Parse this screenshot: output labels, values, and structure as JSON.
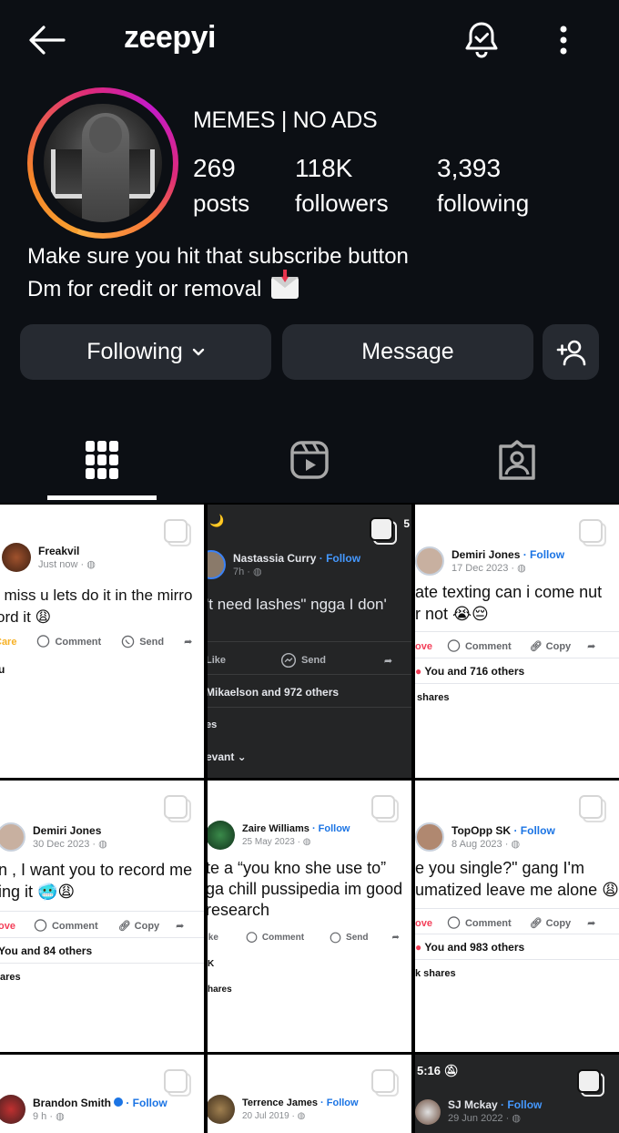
{
  "header": {
    "username": "zeepyi",
    "back_icon": "arrow-left-icon",
    "notifications_icon": "bell-check-icon",
    "more_icon": "more-vertical-icon"
  },
  "profile": {
    "display_name": "MEMES | NO ADS",
    "stats": {
      "posts": {
        "value": "269",
        "label": "posts"
      },
      "followers": {
        "value": "118K",
        "label": "followers"
      },
      "following": {
        "value": "3,393",
        "label": "following"
      }
    },
    "bio": {
      "line1": "Make sure you hit that subscribe button",
      "line2": "Dm for credit or removal",
      "line2_emoji": "envelope-with-arrow-icon"
    },
    "story_ring_colors": [
      "#fcaf45",
      "#f58529",
      "#dd2a7b",
      "#c41ac8"
    ]
  },
  "actions": {
    "following_label": "Following",
    "message_label": "Message",
    "add_user_icon": "person-add-icon"
  },
  "tabs": [
    {
      "name": "posts-grid",
      "icon": "grid-icon",
      "active": true
    },
    {
      "name": "reels",
      "icon": "reels-icon",
      "active": false
    },
    {
      "name": "tagged",
      "icon": "tagged-person-icon",
      "active": false
    }
  ],
  "grid": [
    {
      "author": "Freakvil",
      "follow": "",
      "meta": "Just now ·",
      "text": [
        "i miss u lets do it in the mirro",
        "ord it 😩"
      ],
      "actions": [
        "Care",
        "Comment",
        "Send"
      ],
      "reactions": "u",
      "shares": ""
    },
    {
      "status_time": "🌙",
      "status_right": "5",
      "author": "Nastassia Curry",
      "follow": "· Follow",
      "meta": "7h ·",
      "text": [
        "'t need lashes\" ngga I don'"
      ],
      "actions": [
        "Like",
        "Send"
      ],
      "reactions": "Mikaelson and 972 others",
      "shares": "es",
      "extra": "evant ⌄"
    },
    {
      "author": "Demiri Jones",
      "follow": "· Follow",
      "meta": "17 Dec 2023 ·",
      "text": [
        "ate texting can i come nut",
        "r not 😭😔"
      ],
      "actions": [
        "ove",
        "Comment",
        "Copy"
      ],
      "reactions": "You and 716 others",
      "shares": "shares"
    },
    {
      "author": "Demiri Jones",
      "follow": "",
      "meta": "30 Dec 2023 ·",
      "text": [
        "n , I want you to record me",
        "ing it 🥶😩"
      ],
      "actions": [
        "ove",
        "Comment",
        "Copy"
      ],
      "reactions": "You and 84 others",
      "shares": "ares"
    },
    {
      "author": "Zaire Williams",
      "follow": "· Follow",
      "meta": "25 May 2023 ·",
      "text": [
        "te a “you kno she use to”",
        "ga chill pussipedia im good",
        " research"
      ],
      "actions": [
        "ike",
        "Comment",
        "Send"
      ],
      "reactions": "K",
      "shares": "hares"
    },
    {
      "author": "TopOpp SK",
      "follow": "· Follow",
      "meta": "8 Aug 2023 ·",
      "text": [
        "e you single?\" gang I'm",
        "umatized leave me alone 😩"
      ],
      "actions": [
        "ove",
        "Comment",
        "Copy"
      ],
      "reactions": "You and 983 others",
      "shares": "k shares"
    },
    {
      "author": "Brandon Smith",
      "verified": true,
      "follow": "· Follow",
      "meta": "9 h ·"
    },
    {
      "author": "Terrence James",
      "follow": "· Follow",
      "meta": "20 Jul 2019 ·"
    },
    {
      "status_time": "5:16",
      "author": "SJ Mckay",
      "follow": "· Follow",
      "meta": "29 Jun 2022 ·"
    }
  ]
}
